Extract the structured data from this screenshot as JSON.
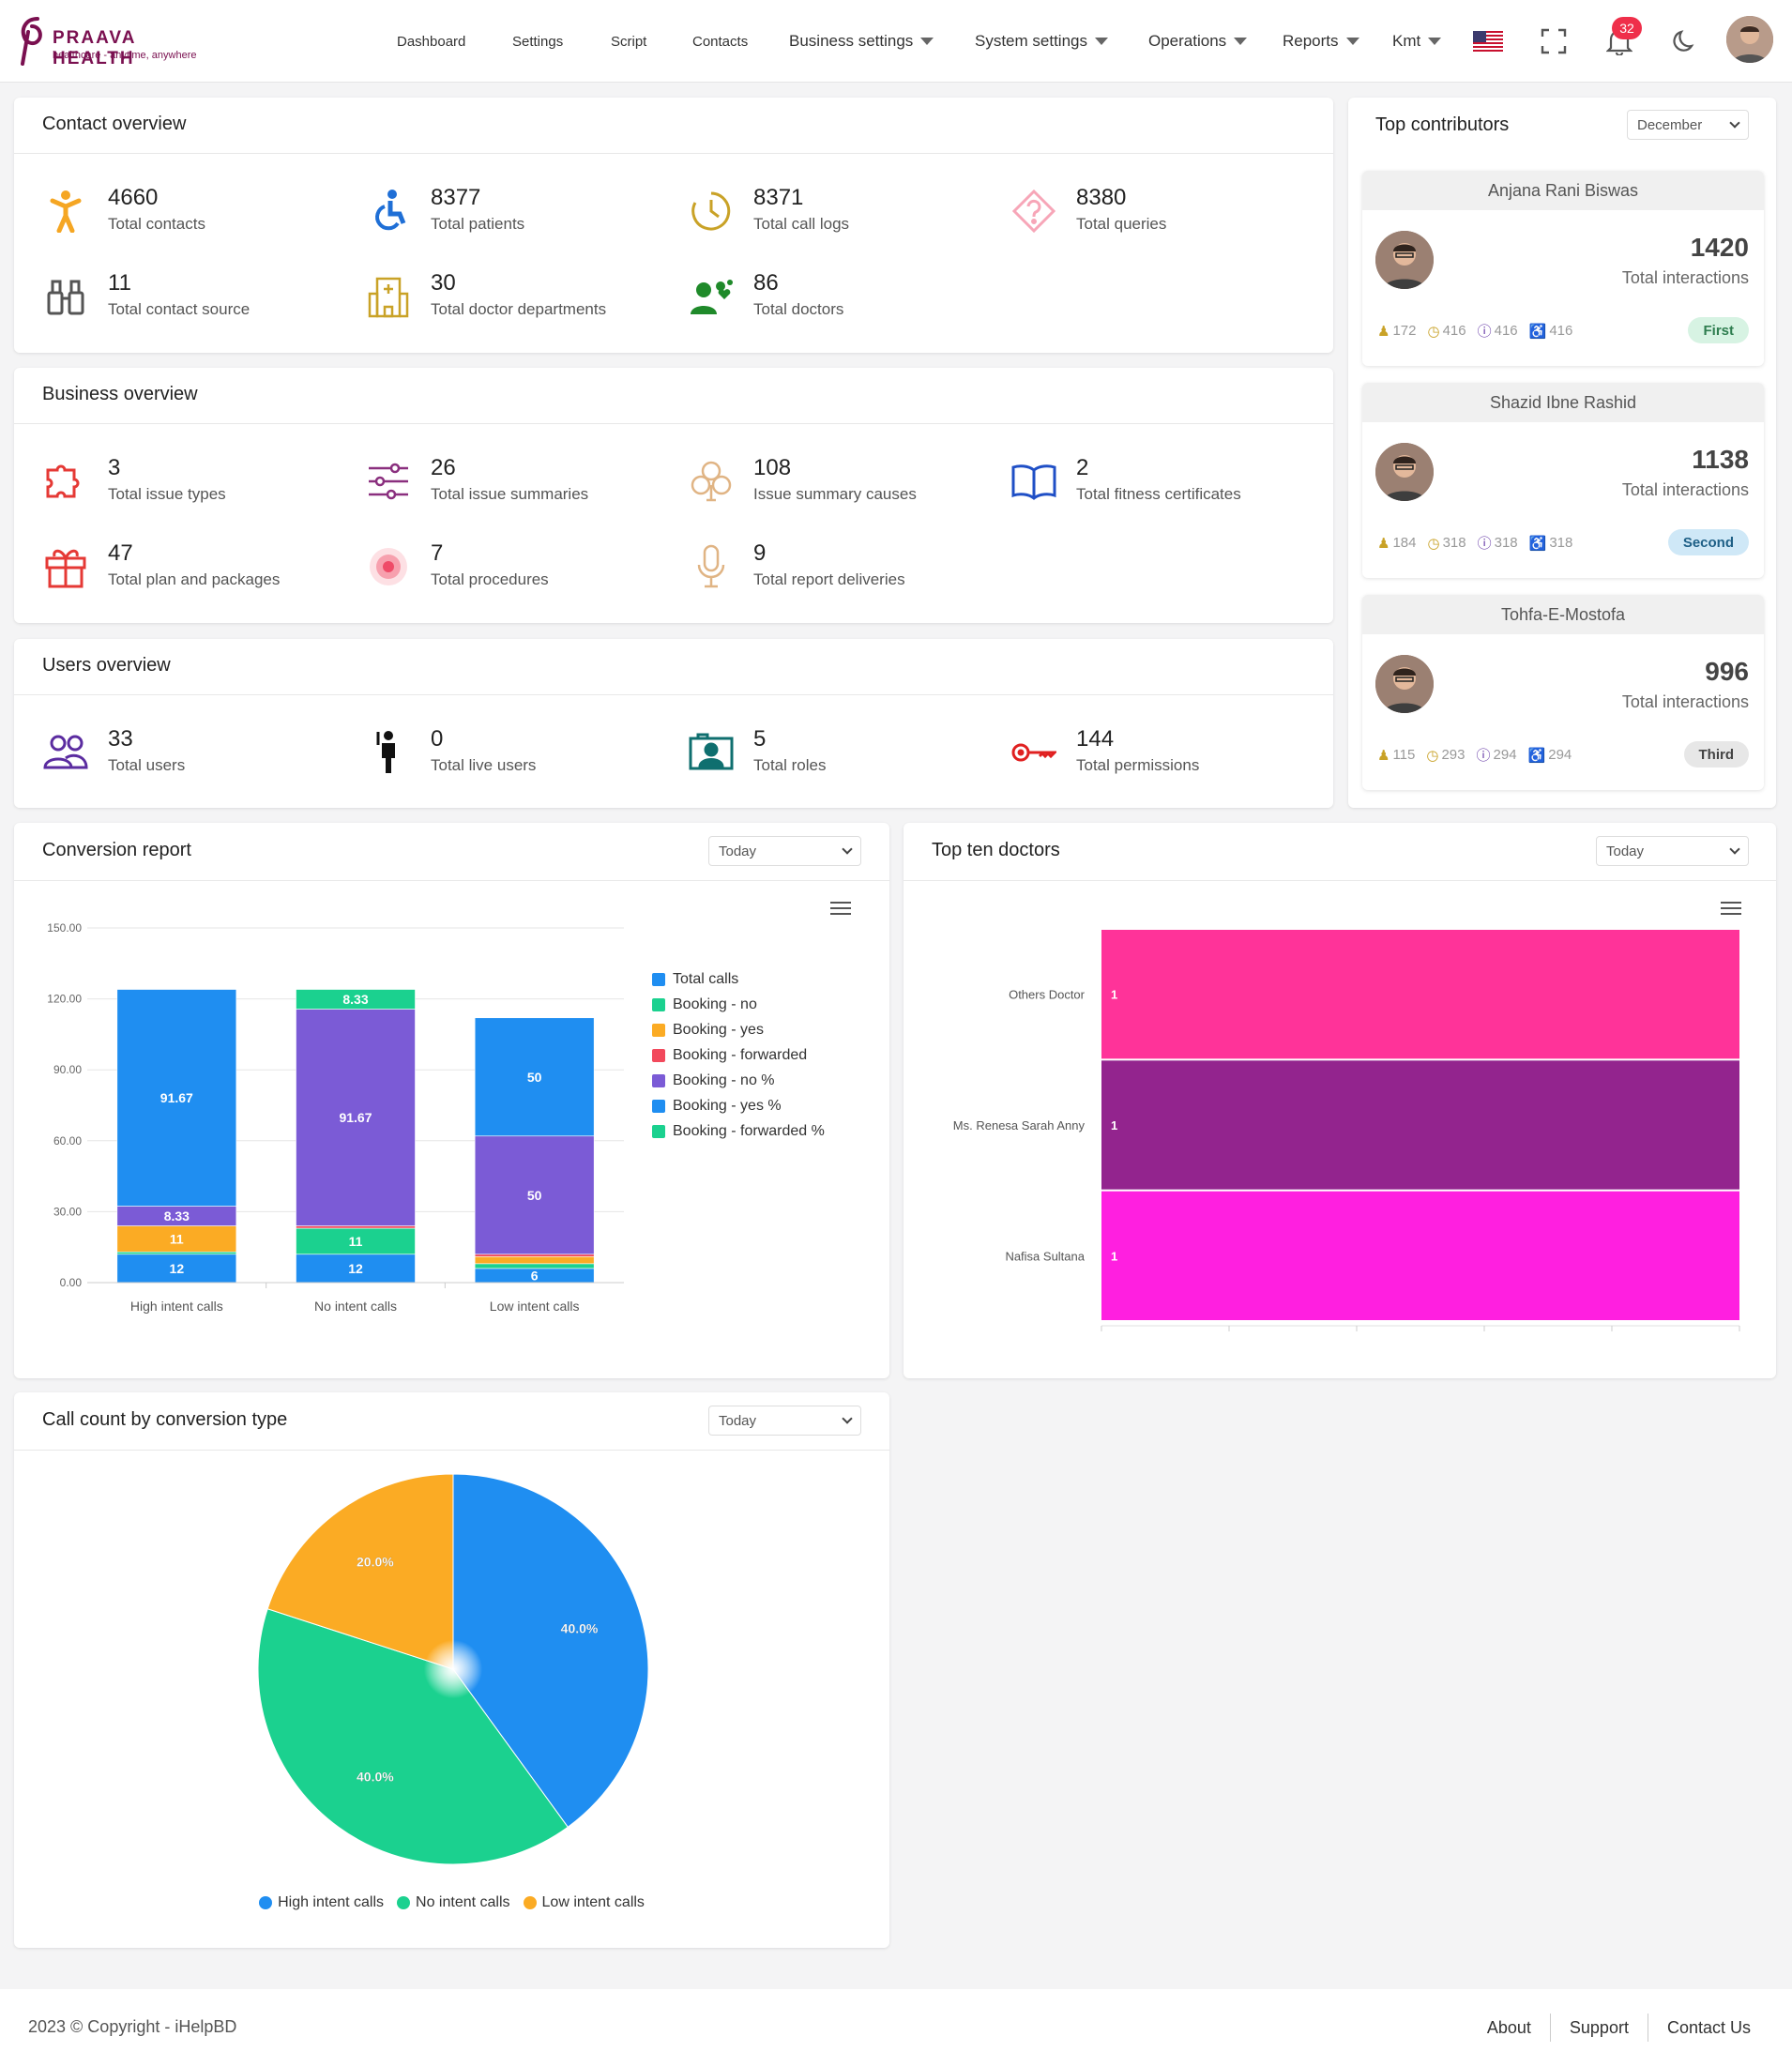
{
  "brand": {
    "name": "PRAAVA HEALTH",
    "tagline": "healthcare - anytime, anywhere"
  },
  "nav": {
    "dashboard": "Dashboard",
    "settings": "Settings",
    "script": "Script",
    "contacts": "Contacts",
    "business_settings": "Business settings",
    "system_settings": "System settings",
    "operations": "Operations",
    "reports": "Reports",
    "user": "Kmt",
    "notif_count": "32"
  },
  "contact_overview": {
    "title": "Contact overview",
    "items": [
      {
        "num": "4660",
        "label": "Total contacts",
        "icon": "person-icon"
      },
      {
        "num": "8377",
        "label": "Total patients",
        "icon": "wheelchair-icon"
      },
      {
        "num": "8371",
        "label": "Total call logs",
        "icon": "clock-icon"
      },
      {
        "num": "8380",
        "label": "Total queries",
        "icon": "question-icon"
      },
      {
        "num": "11",
        "label": "Total contact source",
        "icon": "binoculars-icon"
      },
      {
        "num": "30",
        "label": "Total doctor departments",
        "icon": "hospital-icon"
      },
      {
        "num": "86",
        "label": "Total doctors",
        "icon": "doctors-icon"
      }
    ]
  },
  "business_overview": {
    "title": "Business overview",
    "items": [
      {
        "num": "3",
        "label": "Total issue types",
        "icon": "puzzle-icon"
      },
      {
        "num": "26",
        "label": "Total issue summaries",
        "icon": "sliders-icon"
      },
      {
        "num": "108",
        "label": "Issue summary causes",
        "icon": "clover-icon"
      },
      {
        "num": "2",
        "label": "Total fitness certificates",
        "icon": "book-icon"
      },
      {
        "num": "47",
        "label": "Total plan and packages",
        "icon": "gift-icon"
      },
      {
        "num": "7",
        "label": "Total procedures",
        "icon": "swirl-icon"
      },
      {
        "num": "9",
        "label": "Total report deliveries",
        "icon": "microphone-icon"
      }
    ]
  },
  "users_overview": {
    "title": "Users overview",
    "items": [
      {
        "num": "33",
        "label": "Total users",
        "icon": "users-icon"
      },
      {
        "num": "0",
        "label": "Total live users",
        "icon": "live-user-icon"
      },
      {
        "num": "5",
        "label": "Total roles",
        "icon": "roles-icon"
      },
      {
        "num": "144",
        "label": "Total permissions",
        "icon": "key-icon"
      }
    ]
  },
  "top_contributors": {
    "title": "Top contributors",
    "month": "December",
    "total_label": "Total interactions",
    "people": [
      {
        "name": "Anjana Rani Biswas",
        "total": "1420",
        "m1": "172",
        "m2": "416",
        "m3": "416",
        "m4": "416",
        "rank": "First",
        "rank_bg": "#d7f3e3",
        "rank_fg": "#2e7d4f"
      },
      {
        "name": "Shazid Ibne Rashid",
        "total": "1138",
        "m1": "184",
        "m2": "318",
        "m3": "318",
        "m4": "318",
        "rank": "Second",
        "rank_bg": "#cfe8f7",
        "rank_fg": "#1d5f86"
      },
      {
        "name": "Tohfa-E-Mostofa",
        "total": "996",
        "m1": "115",
        "m2": "293",
        "m3": "294",
        "m4": "294",
        "rank": "Third",
        "rank_bg": "#e7e7e7",
        "rank_fg": "#444"
      }
    ]
  },
  "conversion_report": {
    "title": "Conversion report",
    "filter": "Today"
  },
  "top_doctors": {
    "title": "Top ten doctors",
    "filter": "Today"
  },
  "call_count": {
    "title": "Call count by conversion type",
    "filter": "Today"
  },
  "chart_data": [
    {
      "type": "bar",
      "stacked": true,
      "categories": [
        "High intent calls",
        "No intent calls",
        "Low intent calls"
      ],
      "ylim": [
        0,
        150
      ],
      "yticks": [
        "0.00",
        "30.00",
        "60.00",
        "90.00",
        "120.00",
        "150.00"
      ],
      "legend_position": "right",
      "series": [
        {
          "name": "Total calls",
          "color": "#1f8ef1",
          "values": [
            12,
            12,
            6
          ],
          "labels": [
            "12",
            "12",
            "6"
          ]
        },
        {
          "name": "Booking - no",
          "color": "#1bd18f",
          "values": [
            1,
            11,
            2
          ],
          "labels": [
            "",
            "11",
            ""
          ]
        },
        {
          "name": "Booking - yes",
          "color": "#fbab24",
          "values": [
            11,
            0,
            3
          ],
          "labels": [
            "11",
            "",
            ""
          ]
        },
        {
          "name": "Booking - forwarded",
          "color": "#f2495c",
          "values": [
            0,
            1,
            1
          ],
          "labels": [
            "",
            "",
            ""
          ]
        },
        {
          "name": "Booking - no %",
          "color": "#7b5bd6",
          "values": [
            8.33,
            91.67,
            50
          ],
          "labels": [
            "8.33",
            "91.67",
            "50"
          ]
        },
        {
          "name": "Booking - yes %",
          "color": "#1f8ef1",
          "values": [
            91.67,
            0,
            50
          ],
          "labels": [
            "91.67",
            "",
            "50"
          ]
        },
        {
          "name": "Booking - forwarded %",
          "color": "#1bd18f",
          "values": [
            0,
            8.33,
            0
          ],
          "labels": [
            "",
            "8.33",
            ""
          ]
        }
      ]
    },
    {
      "type": "bar",
      "orientation": "horizontal",
      "categories": [
        "Others Doctor",
        "Ms. Renesa Sarah Anny",
        "Nafisa Sultana"
      ],
      "values": [
        1,
        1,
        1
      ],
      "colors": [
        "#ff3399",
        "#93248e",
        "#ff1fe0"
      ]
    },
    {
      "type": "pie",
      "categories": [
        "High intent calls",
        "No intent calls",
        "Low intent calls"
      ],
      "values": [
        40.0,
        40.0,
        20.0
      ],
      "labels": [
        "40.0%",
        "40.0%",
        "20.0%"
      ],
      "colors": [
        "#1f8ef1",
        "#1bd18f",
        "#fbab24"
      ],
      "legend_position": "bottom"
    }
  ],
  "footer": {
    "copyright": "2023 © Copyright - iHelpBD",
    "about": "About",
    "support": "Support",
    "contact": "Contact Us"
  }
}
